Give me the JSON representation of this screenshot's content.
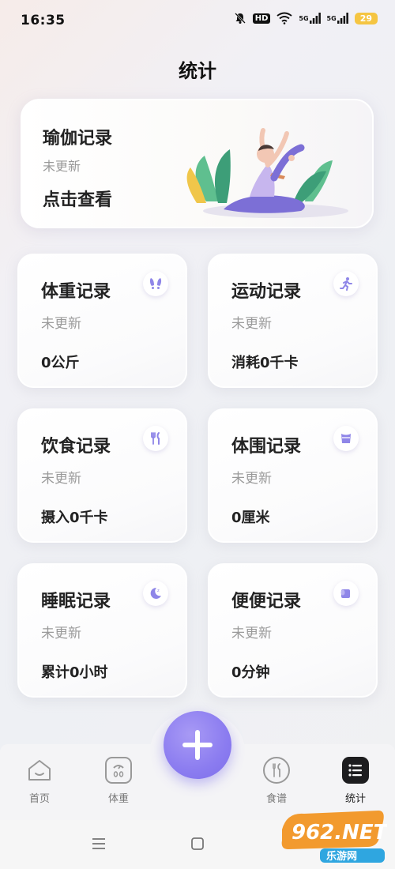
{
  "status_bar": {
    "time": "16:35",
    "hd_badge": "HD",
    "signal1": "5G",
    "signal2": "5G",
    "battery": "29"
  },
  "page": {
    "title": "统计"
  },
  "yoga": {
    "title": "瑜伽记录",
    "status": "未更新",
    "action": "点击查看"
  },
  "cards": [
    {
      "title": "体重记录",
      "status": "未更新",
      "value": "0公斤",
      "icon": "footprints-icon"
    },
    {
      "title": "运动记录",
      "status": "未更新",
      "value": "消耗0千卡",
      "icon": "running-icon"
    },
    {
      "title": "饮食记录",
      "status": "未更新",
      "value": "摄入0千卡",
      "icon": "utensils-icon"
    },
    {
      "title": "体围记录",
      "status": "未更新",
      "value": "0厘米",
      "icon": "body-measure-icon"
    },
    {
      "title": "睡眠记录",
      "status": "未更新",
      "value": "累计0小时",
      "icon": "moon-icon"
    },
    {
      "title": "便便记录",
      "status": "未更新",
      "value": "0分钟",
      "icon": "toilet-paper-icon"
    }
  ],
  "nav": {
    "items": [
      {
        "label": "首页",
        "icon": "home-icon"
      },
      {
        "label": "体重",
        "icon": "scale-icon"
      },
      {
        "label": "食谱",
        "icon": "recipe-icon"
      },
      {
        "label": "统计",
        "icon": "stats-icon",
        "active": true
      }
    ]
  },
  "colors": {
    "accent": "#8b7cf0",
    "accent_light": "#a89af5",
    "icon_purple": "#8f86e8"
  },
  "watermark": {
    "brand": "962.NET",
    "sub": "乐游网"
  }
}
